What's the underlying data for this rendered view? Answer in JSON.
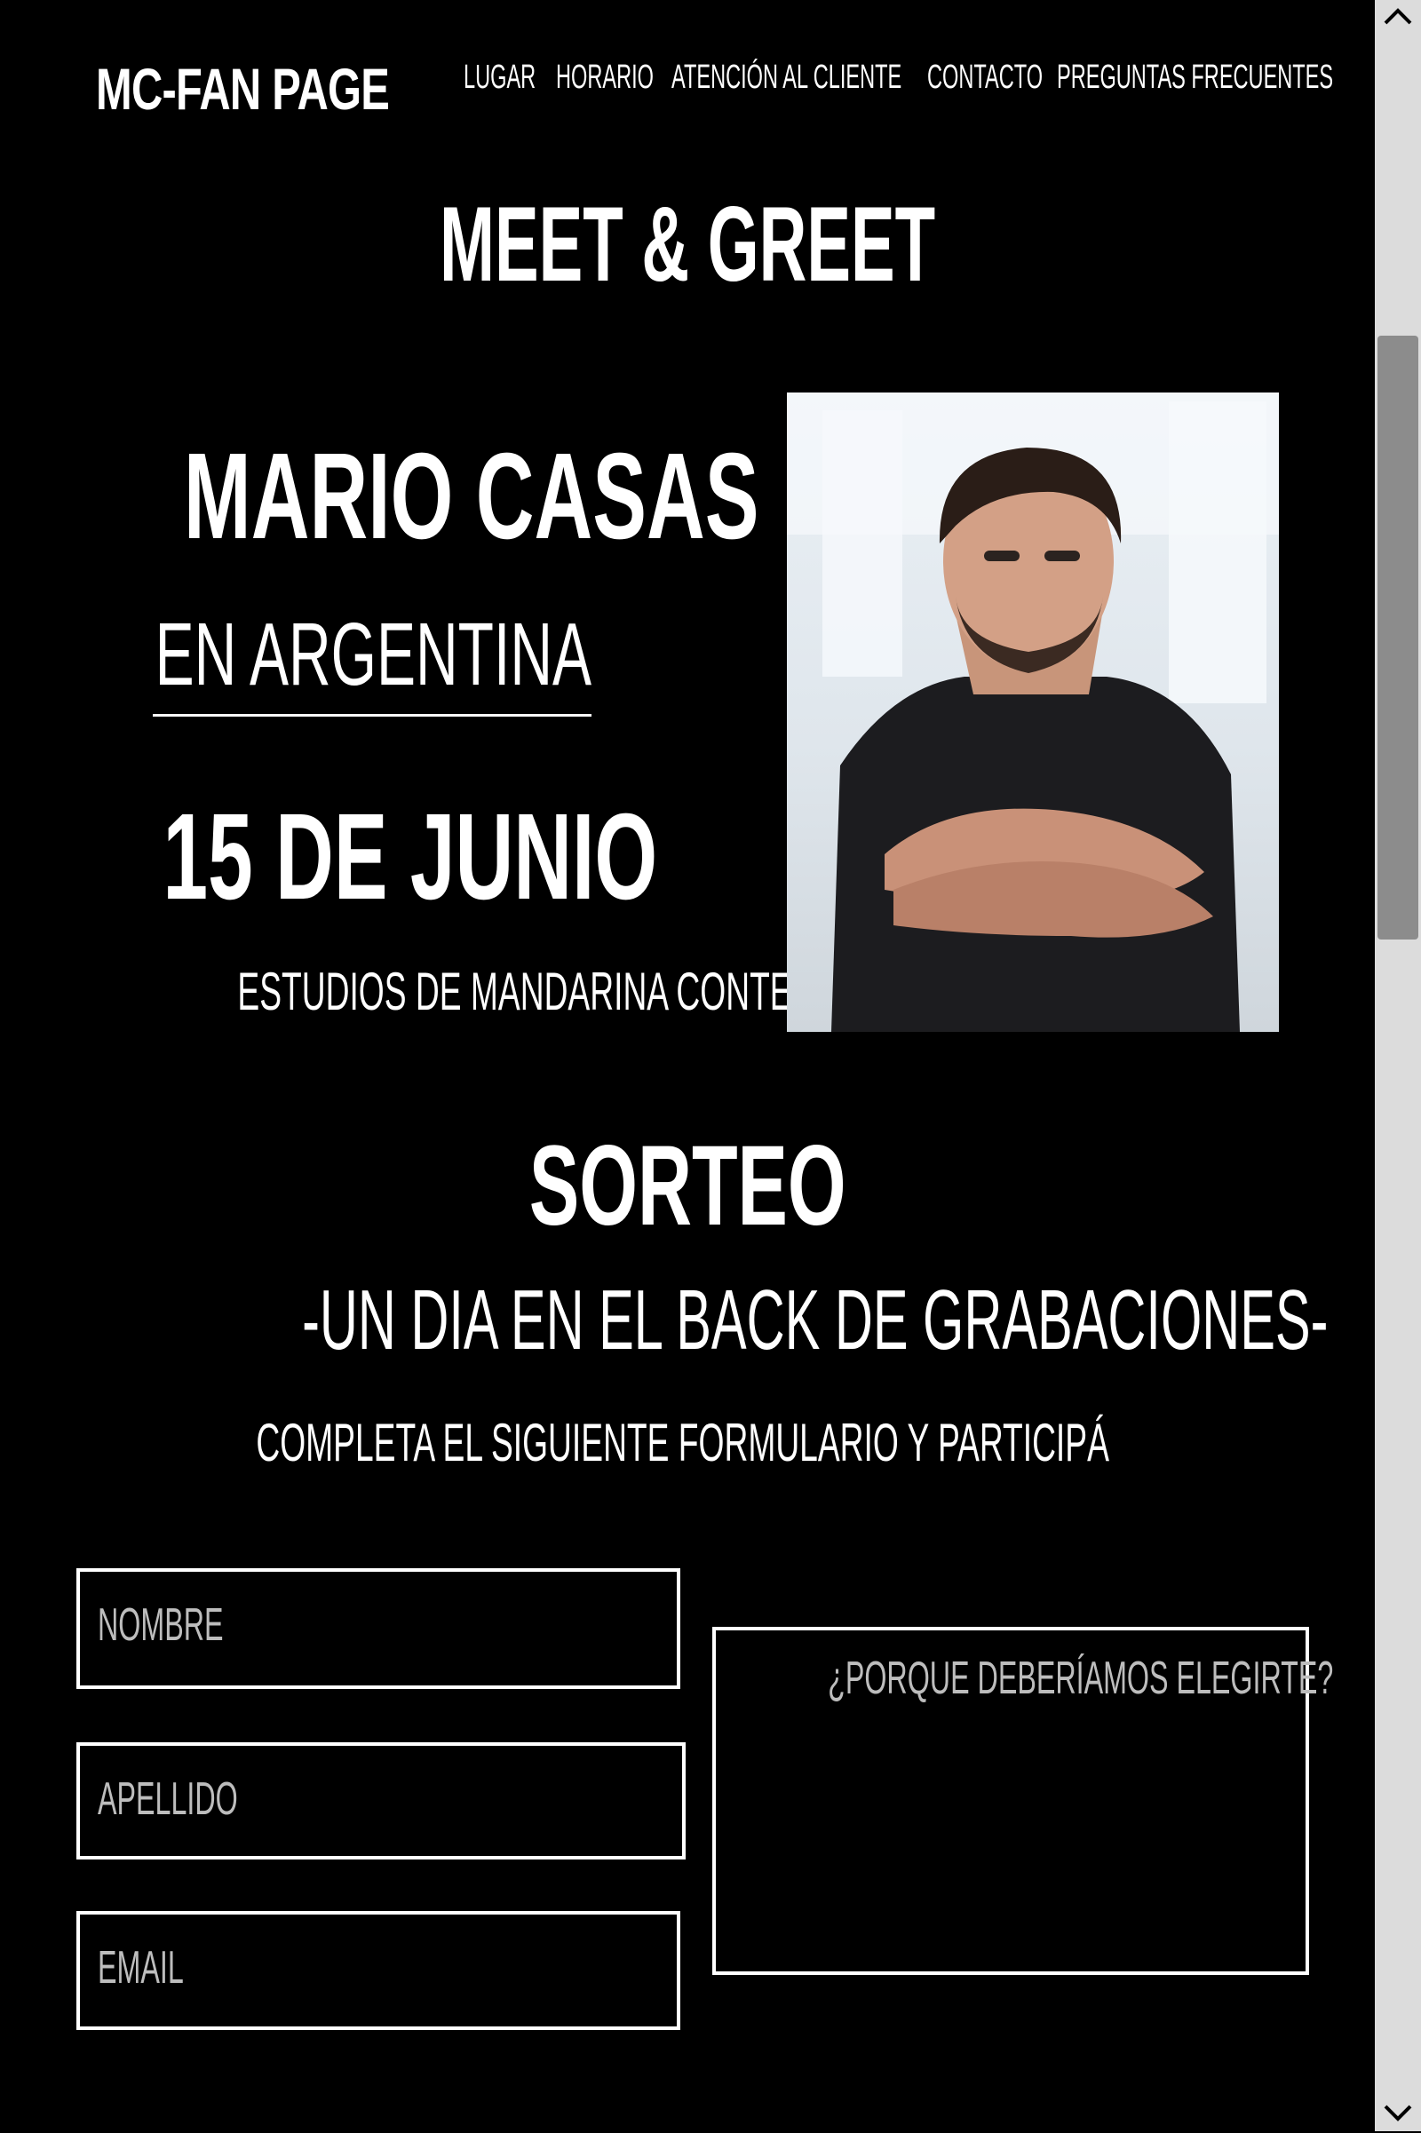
{
  "navbar": {
    "brand": "MC-FAN PAGE",
    "links": [
      "LUGAR",
      "HORARIO",
      "ATENCIÓN AL CLIENTE",
      "CONTACTO",
      "PREGUNTAS FRECUENTES"
    ]
  },
  "hero": {
    "title": "MEET & GREET"
  },
  "event": {
    "artist": "MARIO CASAS",
    "country": "EN ARGENTINA",
    "date": "15 DE JUNIO",
    "venue": "ESTUDIOS DE MANDARINA CONTENIDOS"
  },
  "raffle": {
    "title": "SORTEO",
    "subtitle": "-UN DIA EN EL BACK DE GRABACIONES-",
    "instruction": "COMPLETA EL SIGUIENTE FORMULARIO Y PARTICIPÁ"
  },
  "form": {
    "first_name_placeholder": "NOMBRE",
    "last_name_placeholder": "APELLIDO",
    "email_placeholder": "EMAIL",
    "reason_placeholder": "¿PORQUE DEBERÍAMOS ELEGIRTE?"
  },
  "icons": {
    "scroll_up": "chevron-up-icon",
    "scroll_down": "chevron-down-icon"
  },
  "colors": {
    "background": "#000000",
    "text": "#ffffff",
    "placeholder": "#bdbdbd",
    "scrollbar_thumb": "#8c8c8c"
  }
}
